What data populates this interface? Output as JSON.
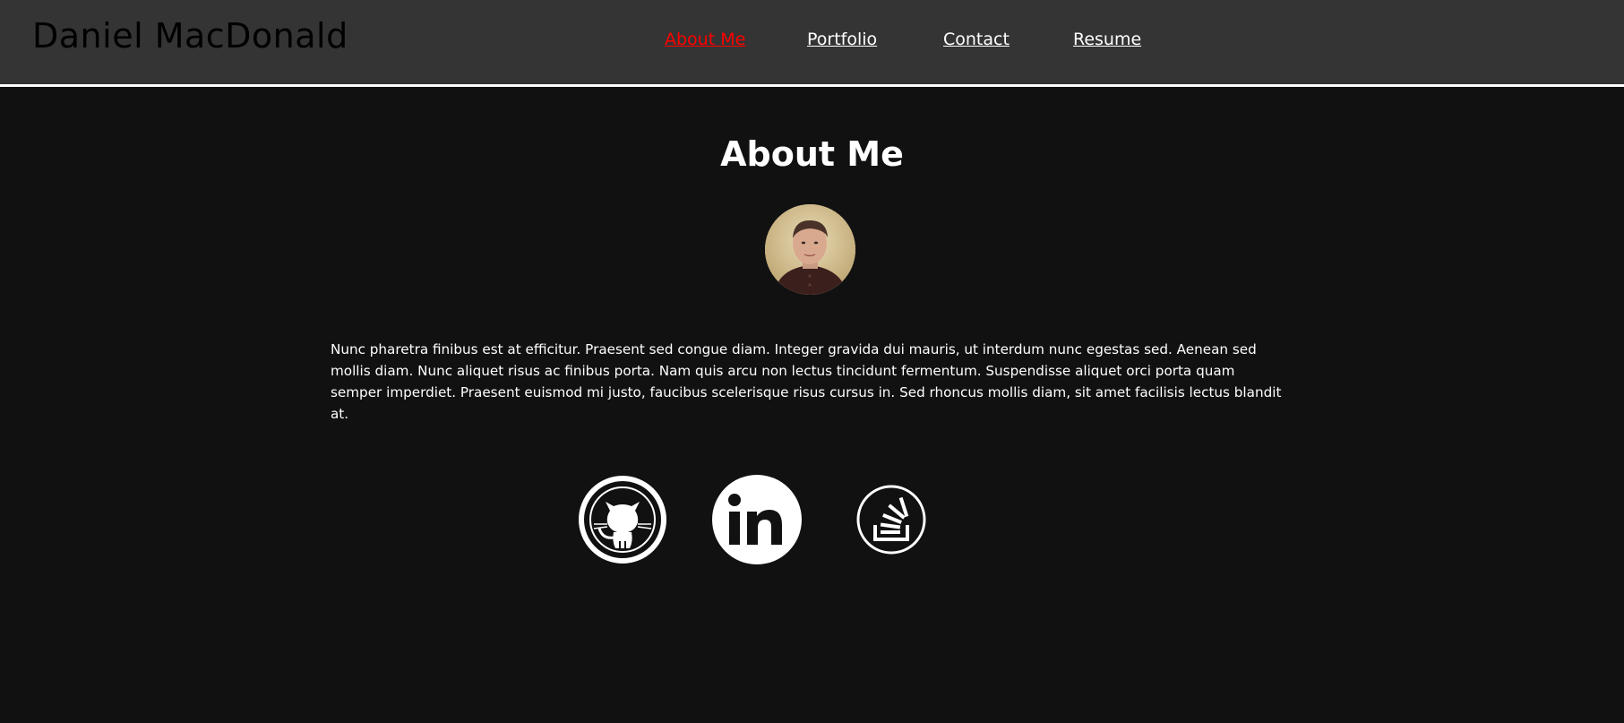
{
  "header": {
    "site_title": "Daniel MacDonald",
    "nav": [
      {
        "label": "About Me",
        "active": true
      },
      {
        "label": "Portfolio",
        "active": false
      },
      {
        "label": "Contact",
        "active": false
      },
      {
        "label": "Resume",
        "active": false
      }
    ]
  },
  "main": {
    "heading": "About Me",
    "bio": "Nunc pharetra finibus est at efficitur. Praesent sed congue diam. Integer gravida dui mauris, ut interdum nunc egestas sed. Aenean sed mollis diam. Nunc aliquet risus ac finibus porta. Nam quis arcu non lectus tincidunt fermentum. Suspendisse aliquet orci porta quam semper imperdiet. Praesent euismod mi justo, faucibus scelerisque risus cursus in. Sed rhoncus mollis diam, sit amet facilisis lectus blandit at."
  },
  "social": [
    {
      "icon": "github-icon"
    },
    {
      "icon": "linkedin-icon"
    },
    {
      "icon": "stackoverflow-icon"
    }
  ],
  "colors": {
    "header_bg": "#343434",
    "page_bg": "#111111",
    "active_link": "#ff0000",
    "text": "#ffffff"
  }
}
